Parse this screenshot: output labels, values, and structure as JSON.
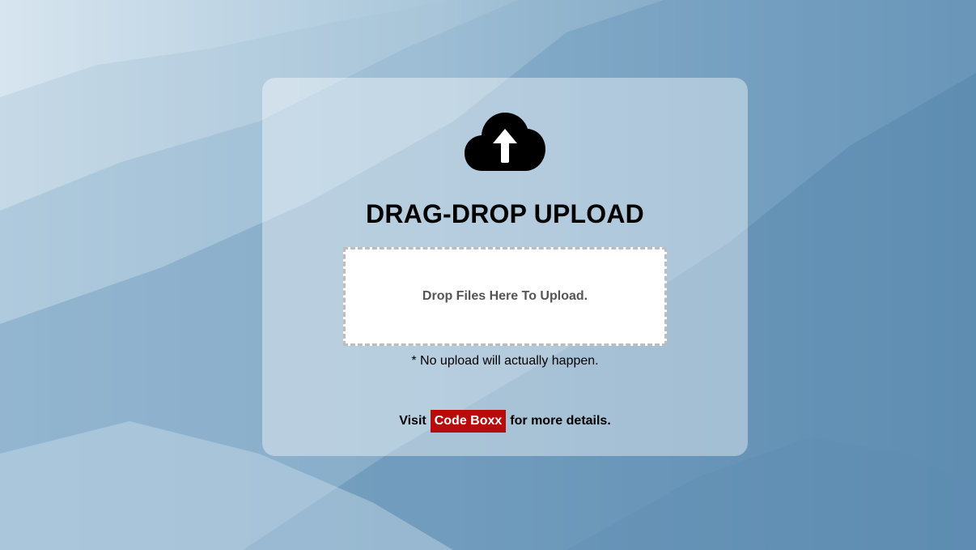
{
  "page": {
    "title": "DRAG-DROP UPLOAD",
    "icon": "cloud-upload-icon"
  },
  "dropzone": {
    "label": "Drop Files Here To Upload."
  },
  "note": "* No upload will actually happen.",
  "footer": {
    "prefix": "Visit",
    "link_label": "Code Boxx",
    "suffix": "for more details."
  },
  "colors": {
    "link_bg": "#b80c0c",
    "link_text": "#ffffff",
    "drop_bg": "#ffffff",
    "drop_border": "#bdbdbd"
  }
}
